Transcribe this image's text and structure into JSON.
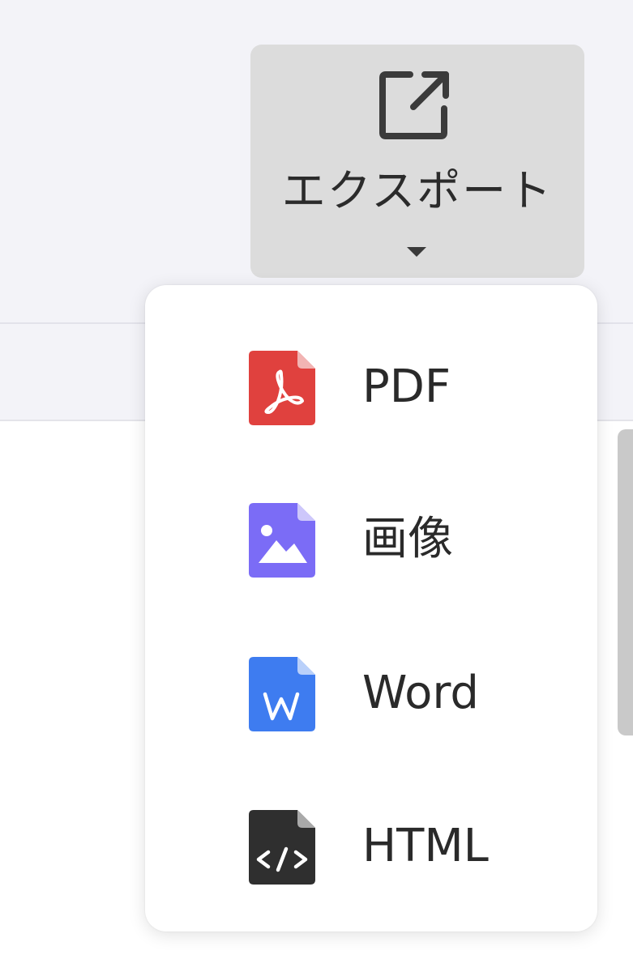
{
  "toolbar": {
    "export_button": {
      "label": "エクスポート",
      "icon": "external-link-icon",
      "caret_icon": "caret-down-icon"
    }
  },
  "export_menu": {
    "items": [
      {
        "label": "PDF",
        "icon": "pdf-file-icon",
        "color": "#e0413e"
      },
      {
        "label": "画像",
        "icon": "image-file-icon",
        "color": "#7b6cf6"
      },
      {
        "label": "Word",
        "icon": "word-file-icon",
        "color": "#3e7cf0"
      },
      {
        "label": "HTML",
        "icon": "html-file-icon",
        "color": "#2f2f2f"
      }
    ]
  },
  "colors": {
    "toolbar_background": "#f3f3f8",
    "button_background": "#dcdcdc",
    "menu_background": "#ffffff",
    "text": "#2a2a2a"
  }
}
